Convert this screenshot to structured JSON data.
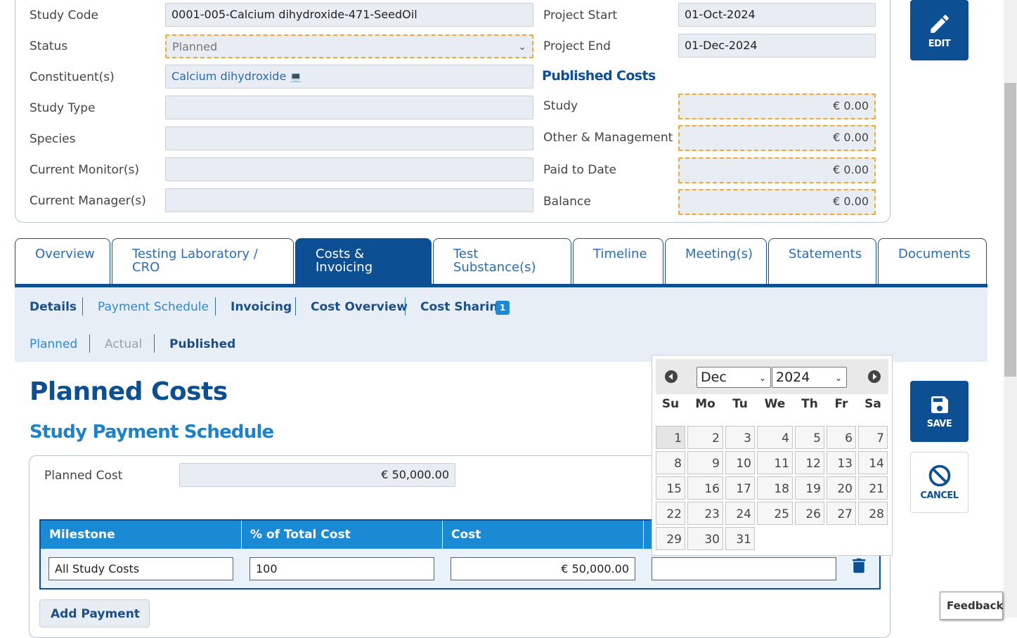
{
  "info": {
    "study_code_label": "Study Code",
    "study_code_value": "0001-005-Calcium dihydroxide-471-SeedOil",
    "status_label": "Status",
    "status_value": "Planned",
    "constituents_label": "Constituent(s)",
    "constituents_value": "Calcium dihydroxide",
    "study_type_label": "Study Type",
    "species_label": "Species",
    "current_monitors_label": "Current Monitor(s)",
    "current_managers_label": "Current Manager(s)",
    "project_start_label": "Project Start",
    "project_start_value": "01-Oct-2024",
    "project_end_label": "Project End",
    "project_end_value": "01-Dec-2024",
    "published_costs_heading": "Published Costs",
    "study_cost_label": "Study",
    "study_cost_value": "€ 0.00",
    "other_label": "Other & Management",
    "other_value": "€ 0.00",
    "paid_label": "Paid to Date",
    "paid_value": "€ 0.00",
    "balance_label": "Balance",
    "balance_value": "€ 0.00"
  },
  "buttons": {
    "edit": "EDIT",
    "save": "SAVE",
    "cancel": "CANCEL"
  },
  "tabs": [
    {
      "label": "Overview"
    },
    {
      "label": "Testing Laboratory / CRO"
    },
    {
      "label": "Costs & Invoicing"
    },
    {
      "label": "Test Substance(s)"
    },
    {
      "label": "Timeline"
    },
    {
      "label": "Meeting(s)"
    },
    {
      "label": "Statements"
    },
    {
      "label": "Documents"
    }
  ],
  "subnav": {
    "details": "Details",
    "payment_schedule": "Payment Schedule",
    "invoicing": "Invoicing",
    "cost_overview": "Cost Overview",
    "cost_sharing": "Cost Sharing",
    "cost_sharing_badge": "1",
    "planned": "Planned",
    "actual": "Actual",
    "published": "Published"
  },
  "main": {
    "title": "Planned Costs",
    "subtitle": "Study Payment Schedule",
    "planned_cost_label": "Planned Cost",
    "planned_cost_value": "€ 50,000.00",
    "columns": [
      "Milestone",
      "% of Total Cost",
      "Cost"
    ],
    "row": {
      "milestone": "All Study Costs",
      "percent": "100",
      "cost": "€ 50,000.00",
      "date": ""
    },
    "add_payment": "Add Payment"
  },
  "datepicker": {
    "month": "Dec",
    "year": "2024",
    "weekdays": [
      "Su",
      "Mo",
      "Tu",
      "We",
      "Th",
      "Fr",
      "Sa"
    ],
    "days": [
      "1",
      "2",
      "3",
      "4",
      "5",
      "6",
      "7",
      "8",
      "9",
      "10",
      "11",
      "12",
      "13",
      "14",
      "15",
      "16",
      "17",
      "18",
      "19",
      "20",
      "21",
      "22",
      "23",
      "24",
      "25",
      "26",
      "27",
      "28",
      "29",
      "30",
      "31"
    ],
    "highlighted_day": "1"
  },
  "feedback": "Feedback",
  "colors": {
    "primary": "#0d4f93",
    "accent": "#1a8ad4",
    "warning_dash": "#f0a830"
  }
}
